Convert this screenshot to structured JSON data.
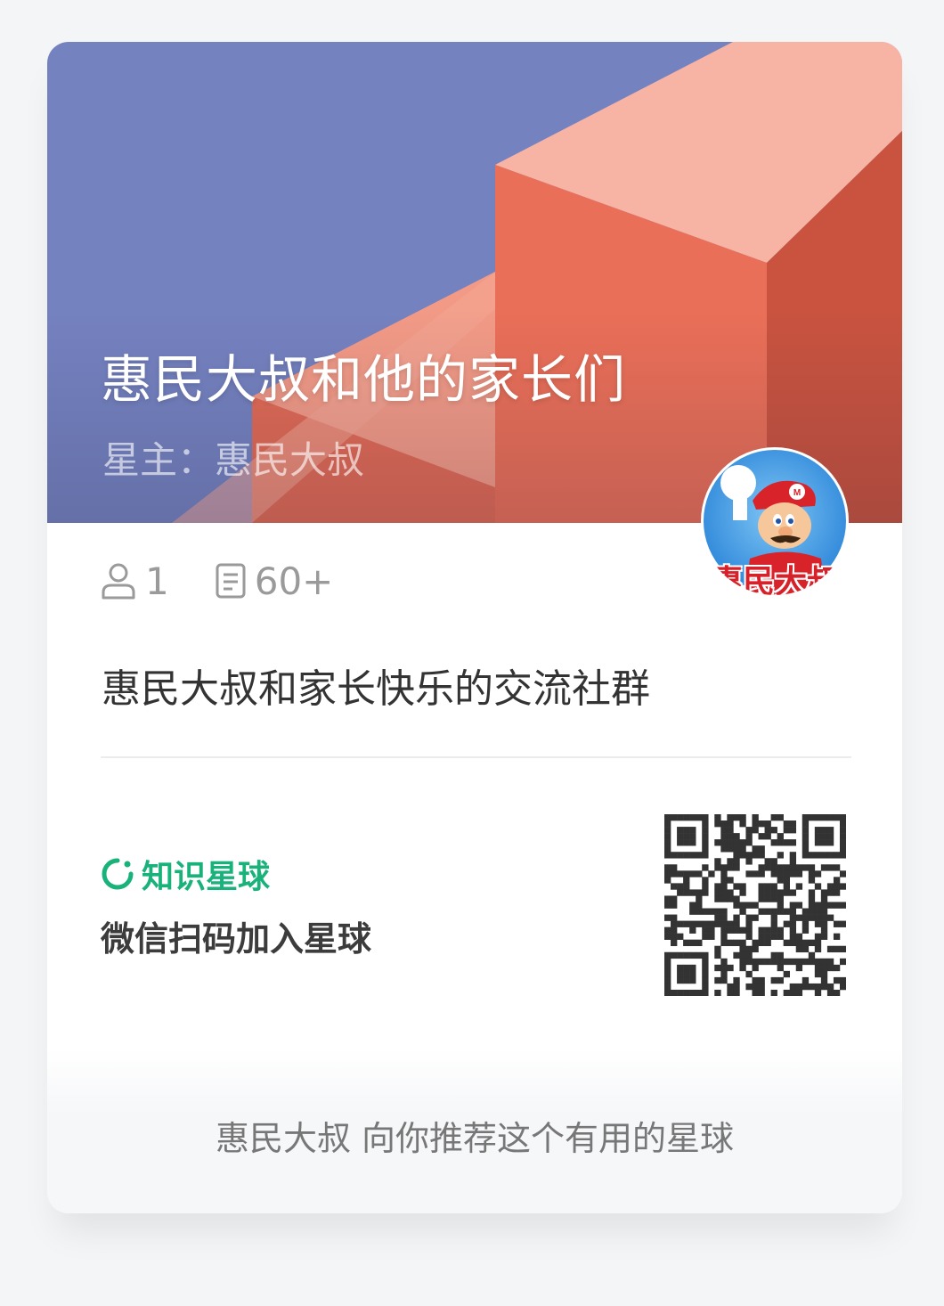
{
  "card": {
    "title": "惠民大叔和他的家长们",
    "owner": "星主：惠民大叔",
    "avatar_text": "惠民大叔",
    "members_count": "1",
    "posts_count": "60+",
    "description": "惠民大叔和家长快乐的交流社群",
    "brand_name": "知识星球",
    "scan_instruction": "微信扫码加入星球",
    "footer": "惠民大叔 向你推荐这个有用的星球"
  },
  "icons": {
    "members": "person-icon",
    "posts": "document-icon",
    "brand": "planet-logo-icon",
    "qr": "qr-code"
  },
  "colors": {
    "banner_blue": "#7582c0",
    "banner_salmon": "#f6a89a",
    "banner_red": "#e9705a",
    "brand_green": "#19b27a",
    "text_dark": "#333333",
    "text_muted": "#9a9a9a"
  }
}
